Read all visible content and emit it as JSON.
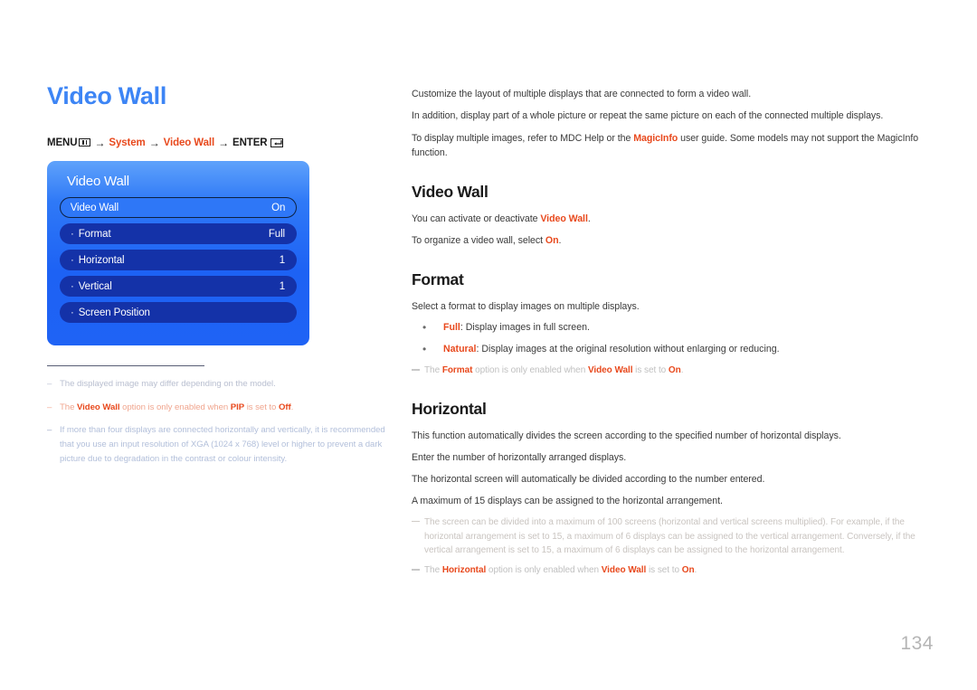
{
  "page": {
    "number": "134"
  },
  "left": {
    "title": "Video Wall",
    "menu_path": {
      "menu_label": "MENU",
      "menu_icon": "menu-grid-icon",
      "arrow": "→",
      "system_label": "System",
      "video_wall_label": "Video Wall",
      "enter_label": "ENTER",
      "enter_icon": "enter-return-icon"
    },
    "osd": {
      "title": "Video Wall",
      "rows": [
        {
          "label": "Video Wall",
          "value": "On",
          "selected": true,
          "prefix": ""
        },
        {
          "label": "Format",
          "value": "Full",
          "selected": false,
          "prefix": "·"
        },
        {
          "label": "Horizontal",
          "value": "1",
          "selected": false,
          "prefix": "·"
        },
        {
          "label": "Vertical",
          "value": "1",
          "selected": false,
          "prefix": "·"
        },
        {
          "label": "Screen Position",
          "value": "",
          "selected": false,
          "prefix": "·"
        }
      ]
    },
    "notes": [
      {
        "dash": "–",
        "parts": [
          {
            "t": "The displayed image may differ depending on the model.",
            "b": false
          }
        ]
      },
      {
        "dash": "–",
        "parts": [
          {
            "t": "The ",
            "b": false
          },
          {
            "t": "Video Wall",
            "b": true
          },
          {
            "t": " option is only enabled when ",
            "b": false
          },
          {
            "t": "PIP",
            "b": true
          },
          {
            "t": " is set to ",
            "b": false
          },
          {
            "t": "Off",
            "b": true
          },
          {
            "t": ".",
            "b": false
          }
        ]
      },
      {
        "dash": "–",
        "parts": [
          {
            "t": "If more than four displays are connected horizontally and vertically, it is recommended that you use an input resolution of XGA (1024 x 768) level or higher to prevent a dark picture due to degradation in the contrast or colour intensity.",
            "b": false
          }
        ]
      }
    ]
  },
  "right": {
    "intro": [
      [
        {
          "t": "Customize the layout of multiple displays that are connected to form a video wall.",
          "b": false
        }
      ],
      [
        {
          "t": "In addition, display part of a whole picture or repeat the same picture on each of the connected multiple displays.",
          "b": false
        }
      ],
      [
        {
          "t": "To display multiple images, refer to MDC Help or the ",
          "b": false
        },
        {
          "t": "MagicInfo",
          "b": true
        },
        {
          "t": " user guide. Some models may not support the MagicInfo function.",
          "b": false
        }
      ]
    ],
    "sections": [
      {
        "heading": "Video Wall",
        "paragraphs": [
          [
            {
              "t": "You can activate or deactivate ",
              "b": false
            },
            {
              "t": "Video Wall",
              "b": true
            },
            {
              "t": ".",
              "b": false
            }
          ],
          [
            {
              "t": "To organize a video wall, select ",
              "b": false
            },
            {
              "t": "On",
              "b": true
            },
            {
              "t": ".",
              "b": false
            }
          ]
        ],
        "bullets": [],
        "notes": []
      },
      {
        "heading": "Format",
        "paragraphs": [
          [
            {
              "t": "Select a format to display images on multiple displays.",
              "b": false
            }
          ]
        ],
        "bullets": [
          [
            {
              "t": "Full",
              "b": true
            },
            {
              "t": ": Display images in full screen.",
              "b": false
            }
          ],
          [
            {
              "t": "Natural",
              "b": true
            },
            {
              "t": ": Display images at the original resolution without enlarging or reducing.",
              "b": false
            }
          ]
        ],
        "notes": [
          [
            {
              "t": "The ",
              "b": false
            },
            {
              "t": "Format",
              "b": true
            },
            {
              "t": " option is only enabled when ",
              "b": false
            },
            {
              "t": "Video Wall",
              "b": true
            },
            {
              "t": " is set to ",
              "b": false
            },
            {
              "t": "On",
              "b": true
            },
            {
              "t": ".",
              "b": false
            }
          ]
        ]
      },
      {
        "heading": "Horizontal",
        "paragraphs": [
          [
            {
              "t": "This function automatically divides the screen according to the specified number of horizontal displays.",
              "b": false
            }
          ],
          [
            {
              "t": "Enter the number of horizontally arranged displays.",
              "b": false
            }
          ],
          [
            {
              "t": "The horizontal screen will automatically be divided according to the number entered.",
              "b": false
            }
          ],
          [
            {
              "t": "A maximum of 15 displays can be assigned to the horizontal arrangement.",
              "b": false
            }
          ]
        ],
        "bullets": [],
        "notes": [
          [
            {
              "t": "The screen can be divided into a maximum of 100 screens (horizontal and vertical screens multiplied). For example, if the horizontal arrangement is set to 15, a maximum of 6 displays can be assigned to the vertical arrangement. Conversely, if the vertical arrangement is set to 15, a maximum of 6 displays can be assigned to the horizontal arrangement.",
              "b": false
            }
          ],
          [
            {
              "t": "The ",
              "b": false
            },
            {
              "t": "Horizontal",
              "b": true
            },
            {
              "t": " option is only enabled when ",
              "b": false
            },
            {
              "t": "Video Wall",
              "b": true
            },
            {
              "t": " is set to ",
              "b": false
            },
            {
              "t": "On",
              "b": true
            },
            {
              "t": ".",
              "b": false
            }
          ]
        ]
      }
    ]
  },
  "colors": {
    "title_blue": "#3d85f5",
    "accent_orange": "#e8491d",
    "osd_panel_top": "#5fa2fb",
    "osd_panel_bottom": "#1f63f5",
    "osd_row": "#1432a8",
    "osd_row_selected": "#2e77f7",
    "body_text": "#3a3a3a",
    "note_text": "#c0c0c0",
    "page_number": "#b5b5b5"
  }
}
